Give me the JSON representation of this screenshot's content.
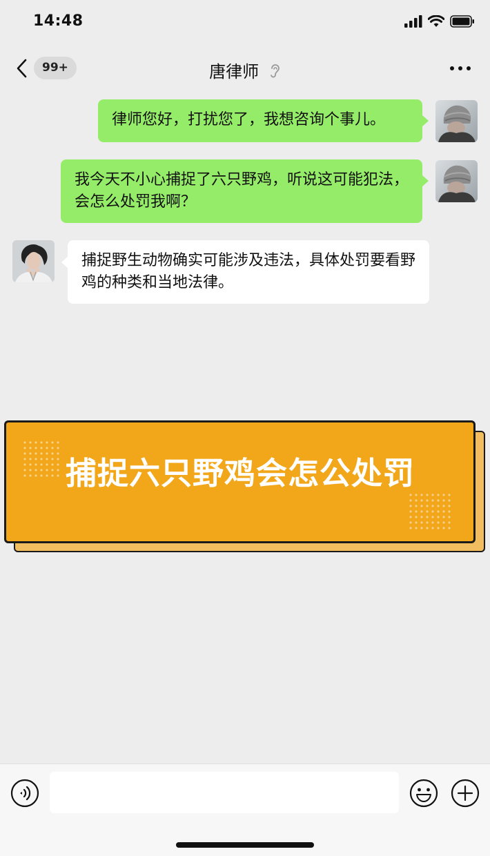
{
  "status_bar": {
    "time": "14:48"
  },
  "nav": {
    "unread_badge": "99+",
    "title": "唐律师"
  },
  "messages": [
    {
      "sender": "me",
      "text": "律师您好，打扰您了，我想咨询个事儿。"
    },
    {
      "sender": "me",
      "text": "我今天不小心捕捉了六只野鸡，听说这可能犯法，会怎么处罚我啊？"
    },
    {
      "sender": "other",
      "text": "捕捉野生动物确实可能涉及违法，具体处罚要看野鸡的种类和当地法律。"
    }
  ],
  "banner": {
    "title": "捕捉六只野鸡会怎公处罚"
  },
  "input_bar": {
    "placeholder": ""
  },
  "colors": {
    "background": "#ededed",
    "my_bubble": "#95ec69",
    "other_bubble": "#ffffff",
    "banner": "#f2a71b",
    "banner_shadow": "#f2bd5e"
  }
}
